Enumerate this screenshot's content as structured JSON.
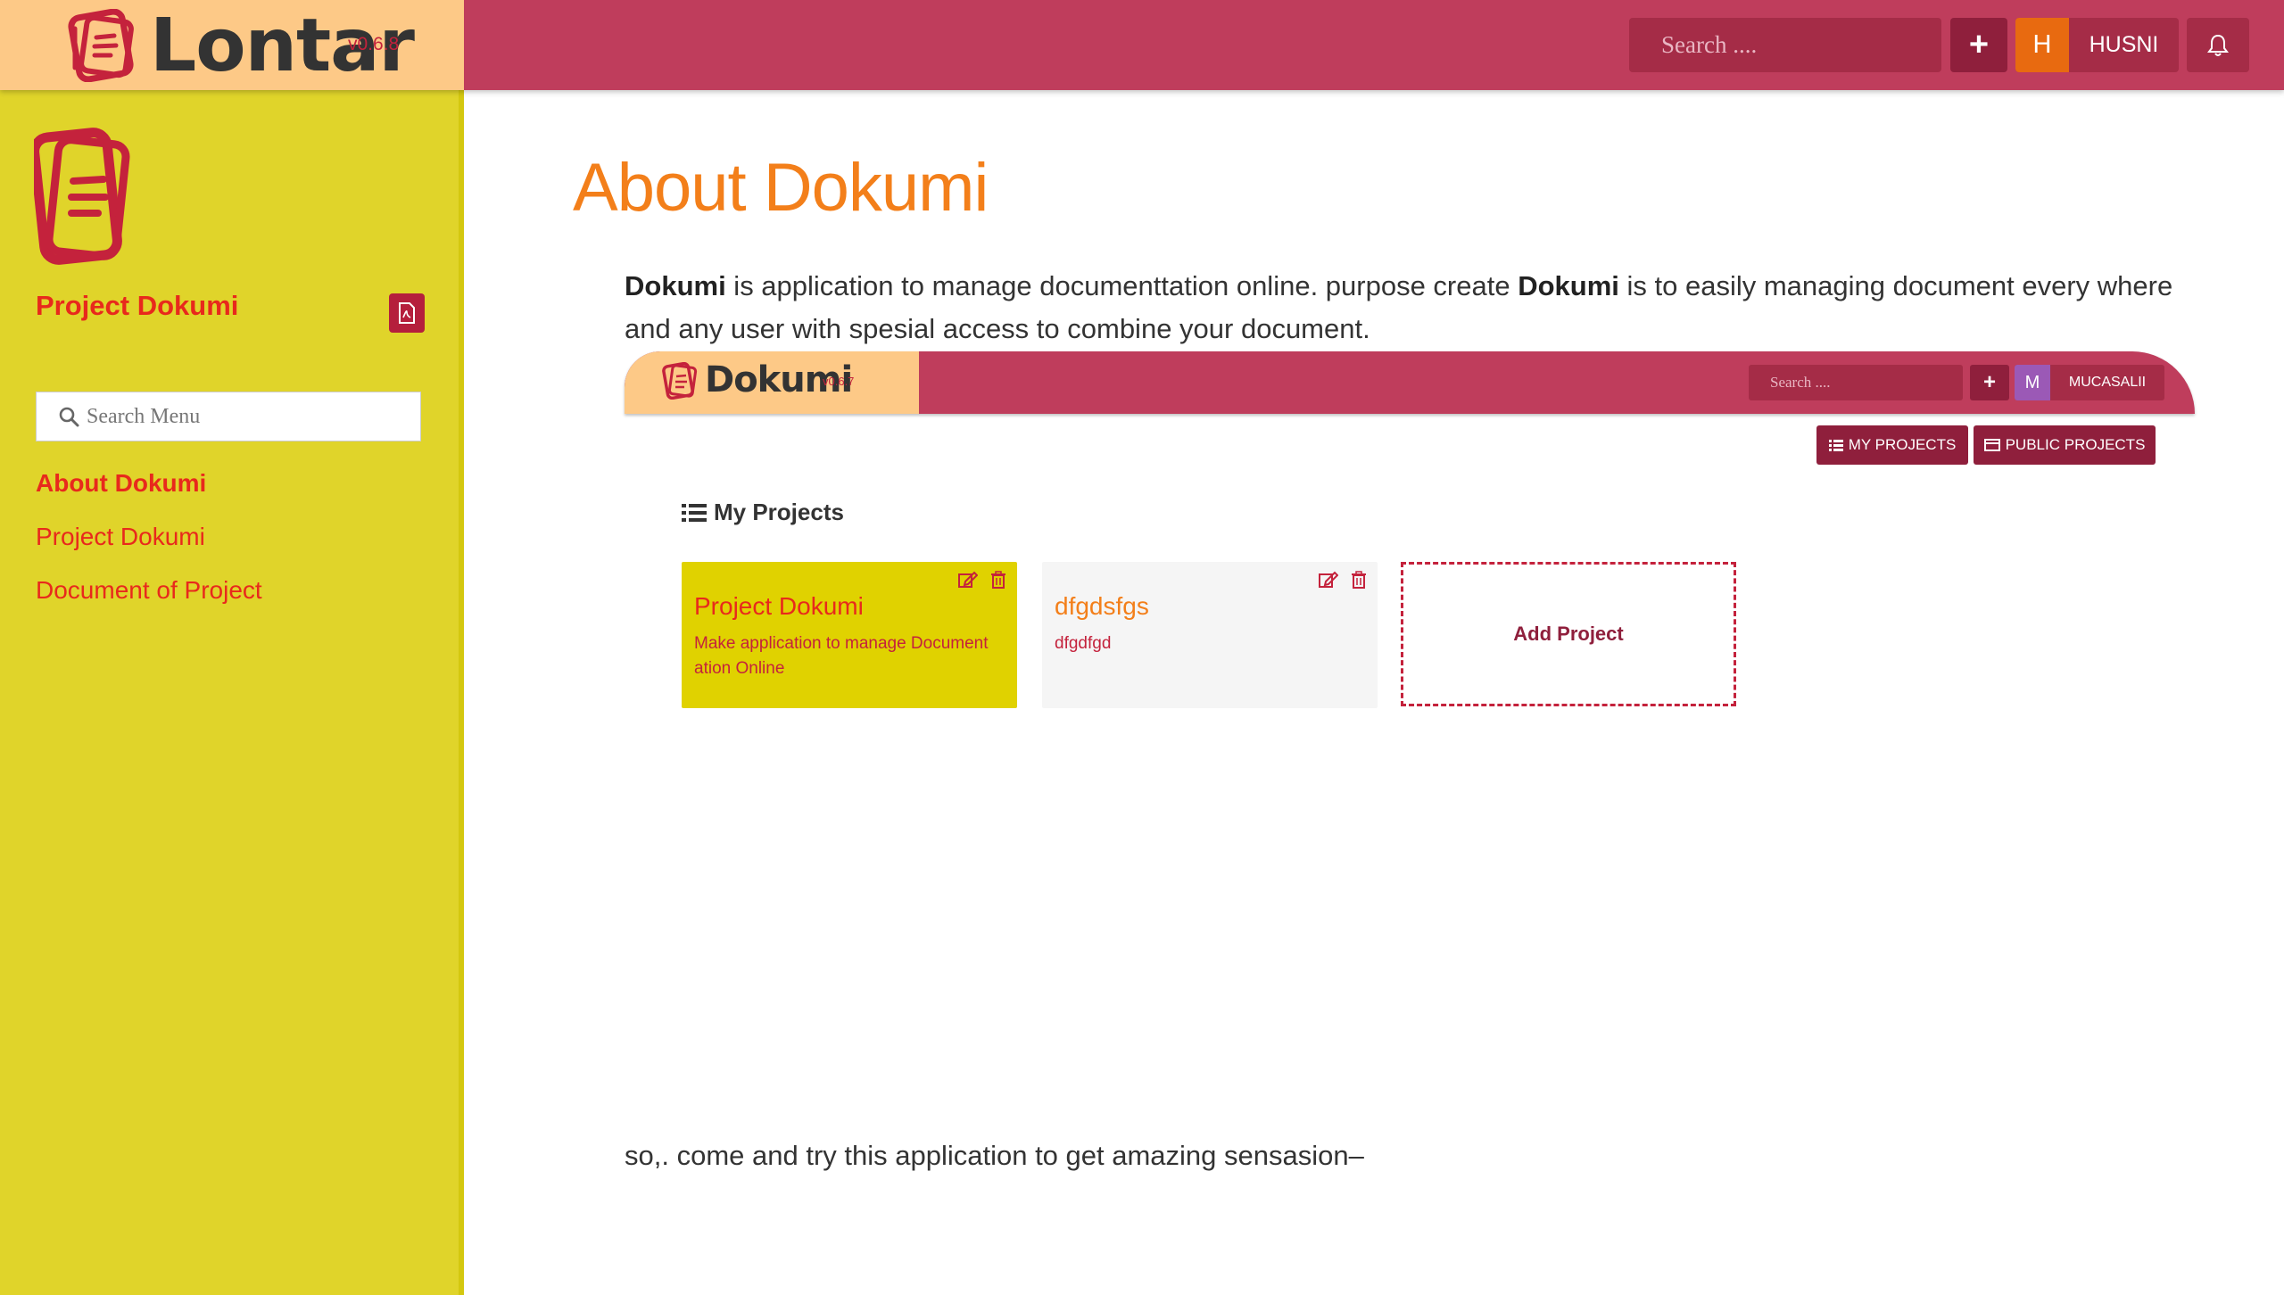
{
  "topbar": {
    "brand_name": "Lontar",
    "brand_version": "v0.6.8",
    "search_placeholder": "Search ....",
    "add_label": "+",
    "user_initial": "H",
    "user_name": "HUSNI"
  },
  "sidebar": {
    "project_title": "Project Dokumi",
    "search_placeholder": "Search Menu",
    "items": [
      {
        "label": "About Dokumi",
        "active": true
      },
      {
        "label": "Project Dokumi",
        "active": false
      },
      {
        "label": "Document of Project",
        "active": false
      }
    ]
  },
  "main": {
    "title": "About Dokumi",
    "intro": {
      "bold1": "Dokumi",
      "text1": " is application to manage documenttation online. purpose create ",
      "bold2": "Dokumi",
      "text2": " is to easily managing document every where and any user with spesial access to combine your document."
    },
    "outro": "so,. come and try this application to get amazing sensasion–"
  },
  "screenshot": {
    "brand_name": "Dokumi",
    "brand_version": "v0.6.7",
    "search_placeholder": "Search ....",
    "add_label": "+",
    "user_initial": "M",
    "user_name": "MUCASALII",
    "btn_my_projects": "MY PROJECTS",
    "btn_public_projects": "PUBLIC PROJECTS",
    "heading": "My Projects",
    "cards": [
      {
        "title": "Project Dokumi",
        "desc": "Make application to manage Document ation Online"
      },
      {
        "title": "dfgdsfgs",
        "desc": "dfgdfgd"
      }
    ],
    "add_project": "Add Project"
  },
  "colors": {
    "topbar": "#bf3d5c",
    "brand_bg": "#fdc987",
    "sidebar": "#e0d42a",
    "accent_red": "#e8291c",
    "title_orange": "#f37f1a",
    "dark_btn": "#8f1f3c"
  }
}
